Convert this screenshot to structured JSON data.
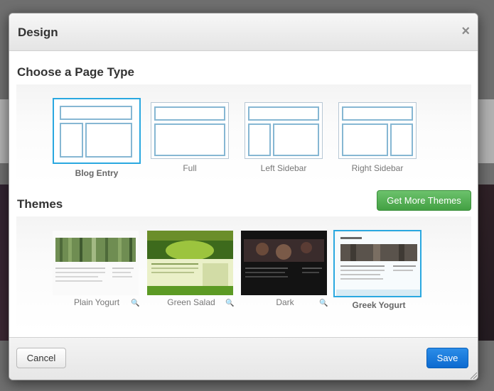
{
  "dialog": {
    "title": "Design",
    "close_icon": "close-icon"
  },
  "page_types": {
    "heading": "Choose a Page Type",
    "items": [
      {
        "label": "Blog Entry",
        "selected": true
      },
      {
        "label": "Full",
        "selected": false
      },
      {
        "label": "Left Sidebar",
        "selected": false
      },
      {
        "label": "Right Sidebar",
        "selected": false
      }
    ]
  },
  "themes": {
    "heading": "Themes",
    "get_more_label": "Get More Themes",
    "items": [
      {
        "label": "Plain Yogurt",
        "selected": false
      },
      {
        "label": "Green Salad",
        "selected": false
      },
      {
        "label": "Dark",
        "selected": false
      },
      {
        "label": "Greek Yogurt",
        "selected": true
      }
    ]
  },
  "footer": {
    "cancel_label": "Cancel",
    "save_label": "Save"
  },
  "colors": {
    "selection": "#2aa8e0",
    "save_button": "#1274d9",
    "more_button": "#52ad52"
  }
}
